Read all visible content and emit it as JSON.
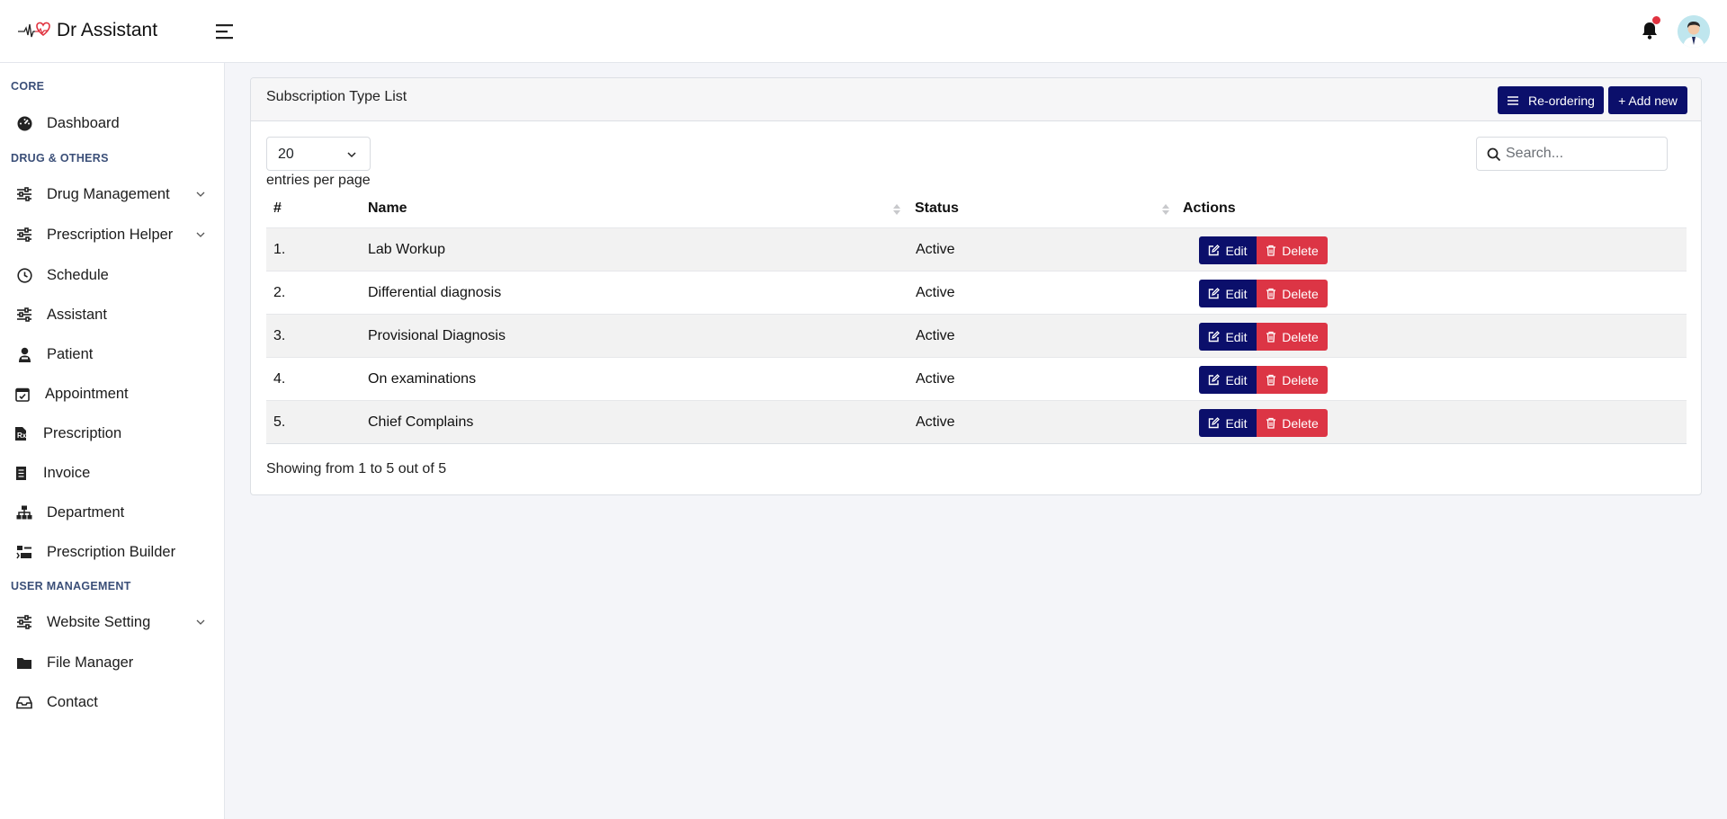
{
  "brand": {
    "name": "Dr Assistant",
    "accent": "#e0323f"
  },
  "header": {
    "notification_dot_color": "#e0323f"
  },
  "sidebar": {
    "sections": [
      {
        "title": "CORE"
      },
      {
        "title": "DRUG & OTHERS"
      },
      {
        "title": "USER MANAGEMENT"
      }
    ],
    "items": [
      {
        "label": "Dashboard",
        "icon": "dashboard-gauge-icon"
      },
      {
        "label": "Drug Management",
        "icon": "sliders-icon",
        "expandable": true
      },
      {
        "label": "Prescription Helper",
        "icon": "sliders-icon",
        "expandable": true
      },
      {
        "label": "Schedule",
        "icon": "clock-icon"
      },
      {
        "label": "Assistant",
        "icon": "sliders-icon"
      },
      {
        "label": "Patient",
        "icon": "user-injured-icon"
      },
      {
        "label": "Appointment",
        "icon": "calendar-check-icon"
      },
      {
        "label": "Prescription",
        "icon": "file-prescription-icon"
      },
      {
        "label": "Invoice",
        "icon": "receipt-icon"
      },
      {
        "label": "Department",
        "icon": "sitemap-icon"
      },
      {
        "label": "Prescription Builder",
        "icon": "builder-icon"
      },
      {
        "label": "Website Setting",
        "icon": "sliders-icon",
        "expandable": true
      },
      {
        "label": "File Manager",
        "icon": "folder-icon"
      },
      {
        "label": "Contact",
        "icon": "inbox-icon"
      }
    ]
  },
  "card": {
    "title": "Subscription Type List",
    "reorder_label": "Re-ordering",
    "add_label": "+ Add new",
    "button_color": "#0b0f6b",
    "danger_color": "#dc3545"
  },
  "table": {
    "per_page_value": "20",
    "per_page_label": "entries per page",
    "search_placeholder": "Search...",
    "columns": [
      "#",
      "Name",
      "Status",
      "Actions"
    ],
    "edit_label": "Edit",
    "delete_label": "Delete",
    "rows": [
      {
        "num": "1.",
        "name": "Lab Workup",
        "status": "Active"
      },
      {
        "num": "2.",
        "name": "Differential diagnosis",
        "status": "Active"
      },
      {
        "num": "3.",
        "name": "Provisional Diagnosis",
        "status": "Active"
      },
      {
        "num": "4.",
        "name": "On examinations",
        "status": "Active"
      },
      {
        "num": "5.",
        "name": "Chief Complains",
        "status": "Active"
      }
    ],
    "showing": "Showing from 1 to 5 out of 5"
  }
}
